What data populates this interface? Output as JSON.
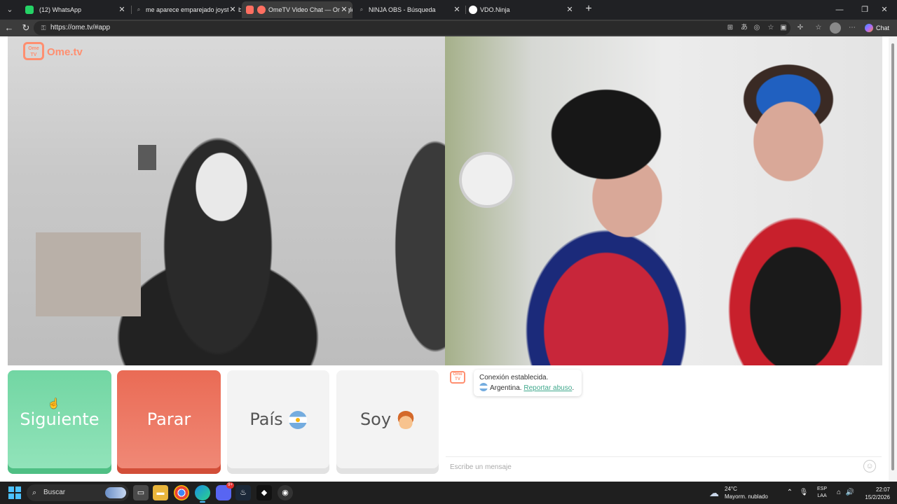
{
  "browser": {
    "tabs": [
      {
        "title": "(12) WhatsApp",
        "badge": "12",
        "color": "#25d366",
        "icon": "whatsapp-icon"
      },
      {
        "title": "me aparece emparejado joystick b",
        "color": "#444444",
        "icon": "search-icon"
      },
      {
        "title": "OmeTV Video Chat — Omegle",
        "color": "#ff6f61",
        "icon": "ometv-icon",
        "active": true
      },
      {
        "title": "NINJA OBS - Búsqueda",
        "color": "#444444",
        "icon": "search-icon"
      },
      {
        "title": "VDO.Ninja",
        "color": "#ffffff",
        "icon": "vdo-ninja-icon"
      }
    ],
    "url": "https://ome.tv/#app",
    "chat_button_label": "Chat"
  },
  "page": {
    "logo_text": "Ome.tv",
    "logo_badge": "Ome TV",
    "buttons": {
      "next": "Siguiente",
      "stop": "Parar",
      "country": "País",
      "gender": "Soy"
    },
    "chat": {
      "message_line1": "Conexión establecida.",
      "country": "Argentina.",
      "report_link": "Reportar abuso",
      "report_suffix": ".",
      "input_placeholder": "Escribe un mensaje"
    }
  },
  "taskbar": {
    "search_label": "Buscar",
    "weather_temp": "24°C",
    "weather_desc": "Mayorm. nublado",
    "lang_line1": "ESP",
    "lang_line2": "LAA",
    "time": "22:07",
    "date": "15/2/2026",
    "discord_badge": "9+"
  },
  "colors": {
    "next_button": "#72d6a3",
    "stop_button": "#ea6b55",
    "brand": "#ff8f70",
    "report_link": "#3fa88c"
  }
}
